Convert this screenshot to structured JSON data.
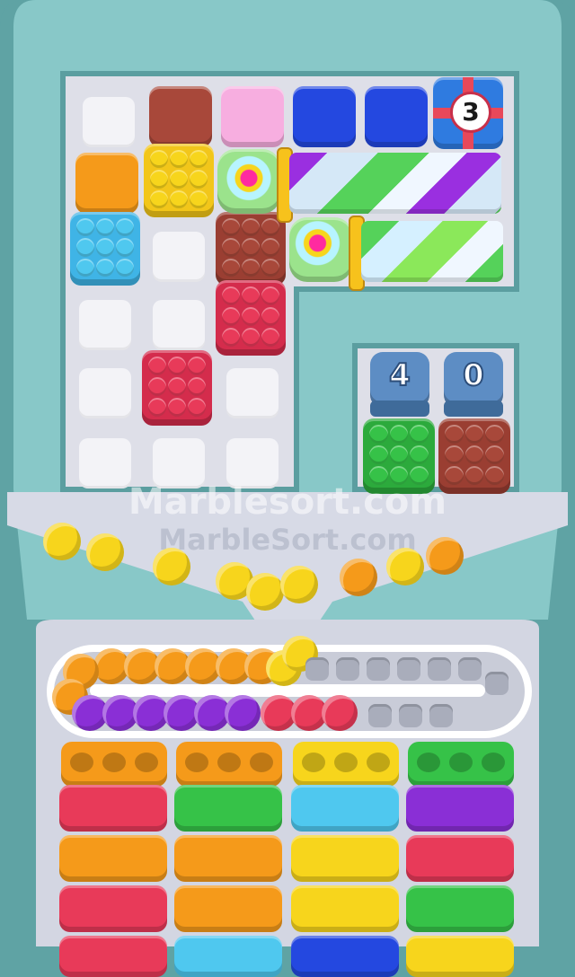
{
  "gift_box": {
    "count": "3"
  },
  "counters": [
    {
      "value": "4"
    },
    {
      "value": "0"
    }
  ],
  "watermark": {
    "line1": "Marblesort.com",
    "line2": "MarbleSort.com"
  },
  "colors": {
    "yellow": "#f7d51c",
    "orange": "#f59a1a",
    "red": "#e83a59",
    "brown": "#a8483a",
    "cyan": "#4fc8ef",
    "green": "#36c248",
    "purple": "#8a2fd6",
    "pink": "#f7aee0",
    "blue": "#2448e0"
  },
  "tray_slots": {
    "filled": [
      "orange",
      "orange",
      "orange",
      "orange",
      "orange",
      "orange",
      "orange",
      "orange",
      "yellow",
      "yellow",
      "purple",
      "purple",
      "purple",
      "purple",
      "purple",
      "purple",
      "red",
      "red",
      "red"
    ],
    "empty_count": 10
  },
  "bins": [
    {
      "top": "orange",
      "stack": [
        "red",
        "orange",
        "red",
        "red"
      ]
    },
    {
      "top": "orange",
      "stack": [
        "green",
        "orange",
        "orange",
        "cyan"
      ]
    },
    {
      "top": "yellow",
      "stack": [
        "cyan",
        "yellow",
        "yellow",
        "blue"
      ]
    },
    {
      "top": "green",
      "stack": [
        "purple",
        "red",
        "green",
        "yellow"
      ]
    }
  ]
}
